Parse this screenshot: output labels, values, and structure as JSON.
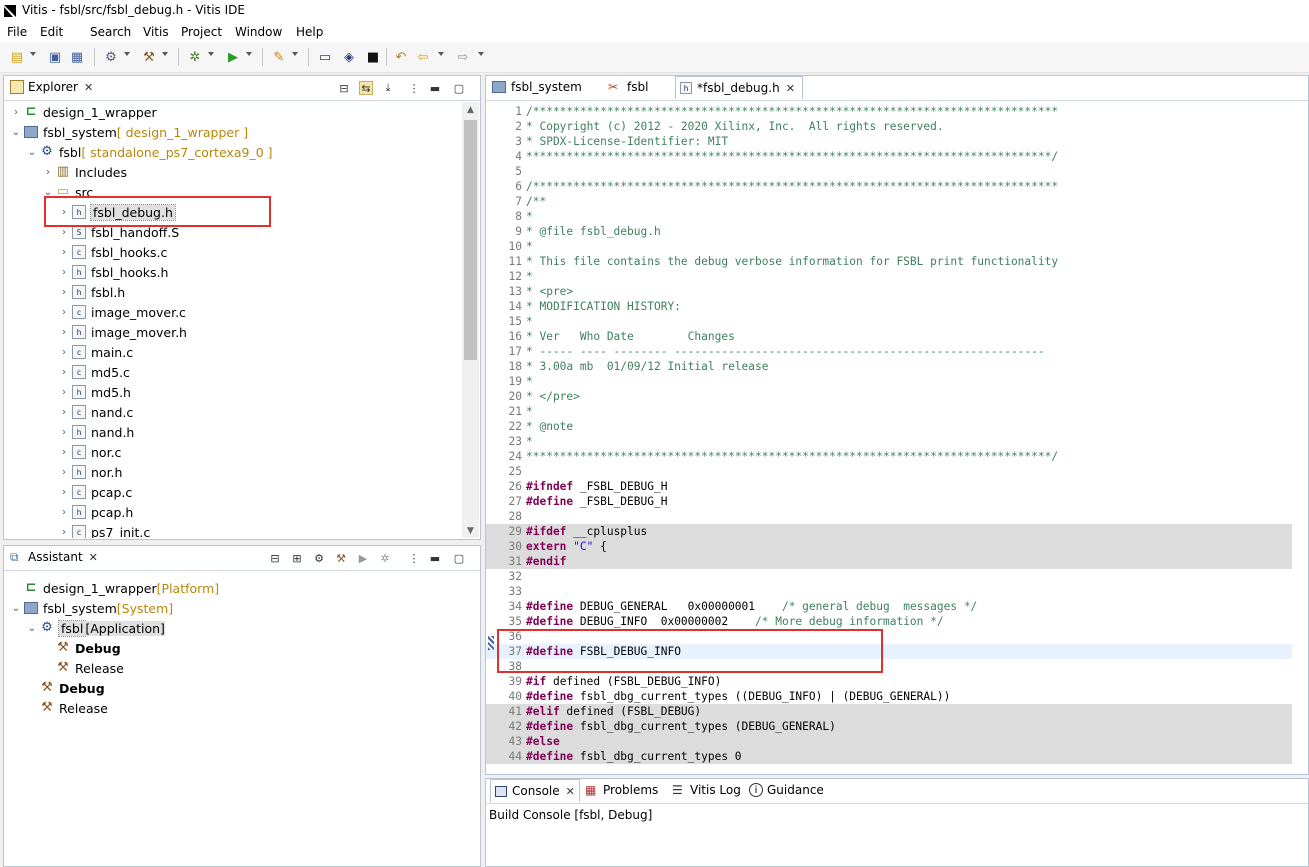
{
  "window": {
    "title": "Vitis - fsbl/src/fsbl_debug.h - Vitis IDE"
  },
  "menu": [
    "File",
    "Edit",
    "Search",
    "Vitis",
    "Project",
    "Window",
    "Help"
  ],
  "explorer": {
    "tab_label": "Explorer",
    "rows": [
      {
        "label": "design_1_wrapper",
        "annotation": "",
        "icon": "platform-icon",
        "arrow": "›",
        "level": 0
      },
      {
        "label": "fsbl_system",
        "annotation": "[ design_1_wrapper ]",
        "icon": "system-icon",
        "arrow": "⌄",
        "level": 0
      },
      {
        "label": "fsbl",
        "annotation": "[ standalone_ps7_cortexa9_0 ]",
        "icon": "app-icon",
        "arrow": "⌄",
        "level": 1
      },
      {
        "label": "Includes",
        "annotation": "",
        "icon": "includes-icon",
        "arrow": "›",
        "level": 2
      },
      {
        "label": "src",
        "annotation": "",
        "icon": "folder-icon",
        "arrow": "⌄",
        "level": 2
      },
      {
        "label": "fsbl_debug.h",
        "annotation": "",
        "icon": "h",
        "arrow": "›",
        "level": 3,
        "selected": true
      },
      {
        "label": "fsbl_handoff.S",
        "annotation": "",
        "icon": "S",
        "arrow": "›",
        "level": 3
      },
      {
        "label": "fsbl_hooks.c",
        "annotation": "",
        "icon": "c",
        "arrow": "›",
        "level": 3
      },
      {
        "label": "fsbl_hooks.h",
        "annotation": "",
        "icon": "h",
        "arrow": "›",
        "level": 3
      },
      {
        "label": "fsbl.h",
        "annotation": "",
        "icon": "h",
        "arrow": "›",
        "level": 3
      },
      {
        "label": "image_mover.c",
        "annotation": "",
        "icon": "c",
        "arrow": "›",
        "level": 3
      },
      {
        "label": "image_mover.h",
        "annotation": "",
        "icon": "h",
        "arrow": "›",
        "level": 3
      },
      {
        "label": "main.c",
        "annotation": "",
        "icon": "c",
        "arrow": "›",
        "level": 3
      },
      {
        "label": "md5.c",
        "annotation": "",
        "icon": "c",
        "arrow": "›",
        "level": 3
      },
      {
        "label": "md5.h",
        "annotation": "",
        "icon": "h",
        "arrow": "›",
        "level": 3
      },
      {
        "label": "nand.c",
        "annotation": "",
        "icon": "c",
        "arrow": "›",
        "level": 3
      },
      {
        "label": "nand.h",
        "annotation": "",
        "icon": "h",
        "arrow": "›",
        "level": 3
      },
      {
        "label": "nor.c",
        "annotation": "",
        "icon": "c",
        "arrow": "›",
        "level": 3
      },
      {
        "label": "nor.h",
        "annotation": "",
        "icon": "h",
        "arrow": "›",
        "level": 3
      },
      {
        "label": "pcap.c",
        "annotation": "",
        "icon": "c",
        "arrow": "›",
        "level": 3
      },
      {
        "label": "pcap.h",
        "annotation": "",
        "icon": "h",
        "arrow": "›",
        "level": 3
      },
      {
        "label": "ps7_init.c",
        "annotation": "",
        "icon": "c",
        "arrow": "›",
        "level": 3
      }
    ]
  },
  "assistant": {
    "tab_label": "Assistant",
    "rows": [
      {
        "label": "design_1_wrapper",
        "annotation": "[Platform]",
        "icon": "platform-icon",
        "arrow": "",
        "level": 0
      },
      {
        "label": "fsbl_system",
        "annotation": "[System]",
        "icon": "system-icon",
        "arrow": "⌄",
        "level": 0
      },
      {
        "label": "fsbl",
        "annotation": "[Application]",
        "icon": "app-icon",
        "arrow": "⌄",
        "level": 1,
        "selected": true
      },
      {
        "label": "Debug",
        "annotation": "",
        "icon": "hammer-icon",
        "arrow": "",
        "level": 2,
        "bold": true
      },
      {
        "label": "Release",
        "annotation": "",
        "icon": "hammer-icon",
        "arrow": "",
        "level": 2
      },
      {
        "label": "Debug",
        "annotation": "",
        "icon": "hammer-icon",
        "arrow": "",
        "level": 1,
        "bold": true
      },
      {
        "label": "Release",
        "annotation": "",
        "icon": "hammer-icon",
        "arrow": "",
        "level": 1
      }
    ]
  },
  "editor": {
    "tabs": [
      {
        "label": "fsbl_system",
        "icon": "system-icon",
        "active": false
      },
      {
        "label": "fsbl",
        "icon": "tools-icon",
        "active": false
      },
      {
        "label": "*fsbl_debug.h",
        "icon": "h-file-icon",
        "active": true
      }
    ],
    "lines": [
      {
        "n": "1",
        "t": "/******************************************************************************",
        "c": "comment"
      },
      {
        "n": "2",
        "t": "* Copyright (c) 2012 - 2020 Xilinx, Inc.  All rights reserved.",
        "c": "comment"
      },
      {
        "n": "3",
        "t": "* SPDX-License-Identifier: MIT",
        "c": "comment"
      },
      {
        "n": "4",
        "t": "******************************************************************************/",
        "c": "comment"
      },
      {
        "n": "5",
        "t": "",
        "c": "plain"
      },
      {
        "n": "6",
        "t": "/******************************************************************************",
        "c": "comment"
      },
      {
        "n": "7",
        "t": "/**",
        "c": "comment"
      },
      {
        "n": "8",
        "t": "*",
        "c": "comment"
      },
      {
        "n": "9",
        "t": "* @file fsbl_debug.h",
        "c": "comment"
      },
      {
        "n": "10",
        "t": "*",
        "c": "comment"
      },
      {
        "n": "11",
        "t": "* This file contains the debug verbose information for FSBL print functionality",
        "c": "comment"
      },
      {
        "n": "12",
        "t": "*",
        "c": "comment"
      },
      {
        "n": "13",
        "t": "* <pre>",
        "c": "comment"
      },
      {
        "n": "14",
        "t": "* MODIFICATION HISTORY:",
        "c": "comment"
      },
      {
        "n": "15",
        "t": "*",
        "c": "comment"
      },
      {
        "n": "16",
        "t": "* Ver   Who Date        Changes",
        "c": "comment"
      },
      {
        "n": "17",
        "t": "* ----- ---- -------- -------------------------------------------------------",
        "c": "comment"
      },
      {
        "n": "18",
        "t": "* 3.00a mb  01/09/12 Initial release",
        "c": "comment"
      },
      {
        "n": "19",
        "t": "*",
        "c": "comment"
      },
      {
        "n": "20",
        "t": "* </pre>",
        "c": "comment"
      },
      {
        "n": "21",
        "t": "*",
        "c": "comment"
      },
      {
        "n": "22",
        "t": "* @note",
        "c": "comment"
      },
      {
        "n": "23",
        "t": "*",
        "c": "comment"
      },
      {
        "n": "24",
        "t": "******************************************************************************/",
        "c": "comment"
      },
      {
        "n": "25",
        "t": "",
        "c": "plain"
      },
      {
        "n": "26",
        "t": "#ifndef _FSBL_DEBUG_H",
        "c": "kw"
      },
      {
        "n": "27",
        "t": "#define _FSBL_DEBUG_H",
        "c": "kw"
      },
      {
        "n": "28",
        "t": "",
        "c": "plain"
      },
      {
        "n": "29",
        "t": "#ifdef __cplusplus",
        "c": "kw",
        "shade": true
      },
      {
        "n": "30",
        "t": "extern \"C\" {",
        "c": "kw",
        "shade": true
      },
      {
        "n": "31",
        "t": "#endif",
        "c": "kw",
        "shade": true
      },
      {
        "n": "32",
        "t": "",
        "c": "plain"
      },
      {
        "n": "33",
        "t": "",
        "c": "plain"
      },
      {
        "n": "34",
        "t": "#define DEBUG_GENERAL   0x00000001    /* general debug  messages */",
        "c": "kw"
      },
      {
        "n": "35",
        "t": "#define DEBUG_INFO  0x00000002    /* More debug information */",
        "c": "kw"
      },
      {
        "n": "36",
        "t": "",
        "c": "plain"
      },
      {
        "n": "37",
        "t": "#define FSBL_DEBUG_INFO",
        "c": "kw",
        "current": true
      },
      {
        "n": "38",
        "t": "",
        "c": "plain"
      },
      {
        "n": "39",
        "t": "#if defined (FSBL_DEBUG_INFO)",
        "c": "kw"
      },
      {
        "n": "40",
        "t": "#define fsbl_dbg_current_types ((DEBUG_INFO) | (DEBUG_GENERAL))",
        "c": "kw"
      },
      {
        "n": "41",
        "t": "#elif defined (FSBL_DEBUG)",
        "c": "kw",
        "shade": true
      },
      {
        "n": "42",
        "t": "#define fsbl_dbg_current_types (DEBUG_GENERAL)",
        "c": "kw",
        "shade": true
      },
      {
        "n": "43",
        "t": "#else",
        "c": "kw",
        "shade": true
      },
      {
        "n": "44",
        "t": "#define fsbl_dbg_current_types 0",
        "c": "kw",
        "shade": true
      }
    ]
  },
  "console": {
    "tabs": [
      {
        "label": "Console",
        "icon": "console-icon"
      },
      {
        "label": "Problems",
        "icon": "problems-icon"
      },
      {
        "label": "Vitis Log",
        "icon": "log-icon"
      },
      {
        "label": "Guidance",
        "icon": "info-icon"
      }
    ],
    "subtitle": "Build Console [fsbl, Debug]"
  }
}
